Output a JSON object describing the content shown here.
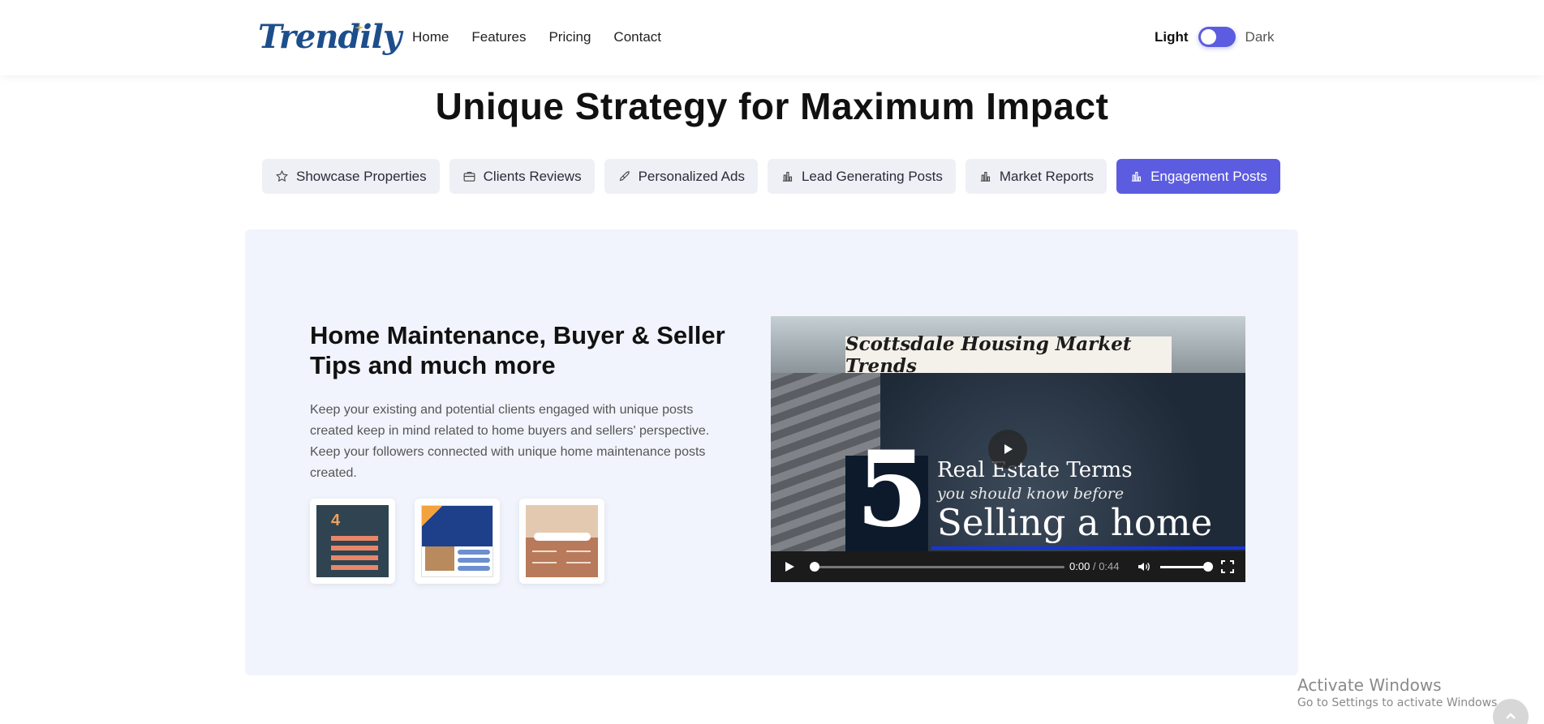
{
  "header": {
    "logo": "Trendily",
    "nav": [
      "Home",
      "Features",
      "Pricing",
      "Contact"
    ],
    "theme_light": "Light",
    "theme_dark": "Dark"
  },
  "hero": {
    "title": "Unique Strategy for Maximum Impact"
  },
  "tabs": [
    {
      "label": "Showcase Properties",
      "icon": "star-icon",
      "active": false
    },
    {
      "label": "Clients Reviews",
      "icon": "briefcase-icon",
      "active": false
    },
    {
      "label": "Personalized Ads",
      "icon": "rocket-icon",
      "active": false
    },
    {
      "label": "Lead Generating Posts",
      "icon": "bar-chart-icon",
      "active": false
    },
    {
      "label": "Market Reports",
      "icon": "bar-chart-icon",
      "active": false
    },
    {
      "label": "Engagement Posts",
      "icon": "bar-chart-icon",
      "active": true
    }
  ],
  "panel": {
    "title": "Home Maintenance, Buyer & Seller Tips and much more",
    "description": "Keep your existing and potential clients engaged with unique posts created keep in mind related to home buyers and sellers' perspective. Keep your followers connected with unique home maintenance posts created.",
    "thumb1_number": "4",
    "video": {
      "banner": "Scottsdale Housing Market Trends",
      "big_number": "5",
      "line1": "Real Estate Terms",
      "line2": "you should know before",
      "line3": "Selling a home",
      "current_time": "0:00",
      "separator": "/",
      "duration": "0:44"
    }
  },
  "watermark": {
    "line1": "Activate Windows",
    "line2": "Go to Settings to activate Windows."
  },
  "colors": {
    "accent": "#5c5ce0",
    "panel_bg": "#f1f4fc",
    "tab_bg": "#eef0f6"
  }
}
